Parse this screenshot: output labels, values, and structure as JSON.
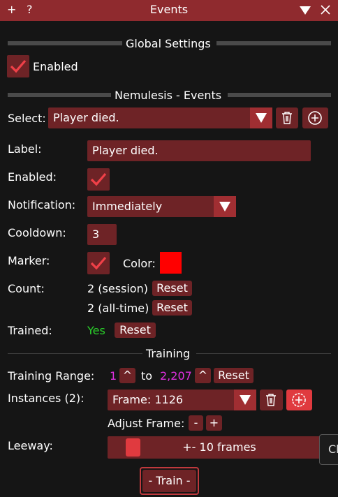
{
  "window": {
    "title": "Events",
    "plus_label": "+",
    "help_label": "?"
  },
  "global": {
    "section_title": "Global Settings",
    "enabled_label": "Enabled",
    "enabled": true
  },
  "events": {
    "section_title": "Nemulesis - Events",
    "select_label": "Select:",
    "select_value": "Player died."
  },
  "form": {
    "label_label": "Label:",
    "label_value": "Player died.",
    "enabled_label": "Enabled:",
    "enabled": true,
    "notification_label": "Notification:",
    "notification_value": "Immediately",
    "cooldown_label": "Cooldown:",
    "cooldown_value": "3",
    "marker_label": "Marker:",
    "marker": true,
    "color_label": "Color:",
    "marker_color": "#ff0000",
    "count_label": "Count:",
    "count_session": "2 (session)",
    "count_alltime": "2 (all-time)",
    "reset_label": "Reset",
    "trained_label": "Trained:",
    "trained_value": "Yes"
  },
  "training": {
    "section_title": "Training",
    "range_label": "Training Range:",
    "range_start": "1",
    "range_to": "to",
    "range_end": "2,207",
    "up_label": "^",
    "reset_label": "Reset",
    "instances_label": "Instances (2):",
    "instance_value": "Frame: 1126",
    "adjust_label": "Adjust Frame:",
    "minus_label": "-",
    "plus_label": "+",
    "leeway_label": "Leeway:",
    "leeway_value": "+- 10 frames",
    "train_label": "- Train -"
  },
  "side_tab": {
    "label": "Cl"
  },
  "colors": {
    "titlebar": "#8f2a2e",
    "frame": "#6e2326",
    "accent": "#e03a3f",
    "magenta": "#e02fe0",
    "green": "#2ad12a"
  }
}
